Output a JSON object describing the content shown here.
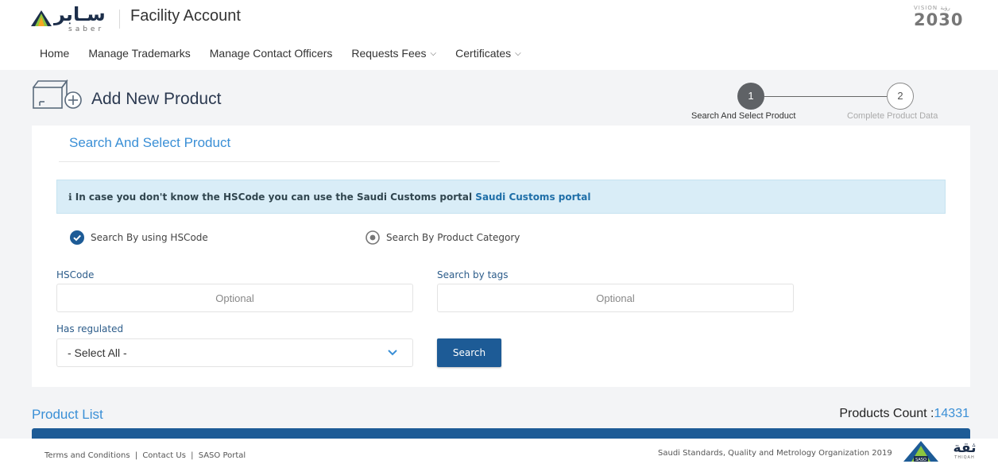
{
  "header": {
    "logo_arabic": "سـابر",
    "logo_latin": "saber",
    "title": "Facility Account",
    "vision_small": "VISION رؤية",
    "vision_year": "2030"
  },
  "nav": {
    "items": [
      {
        "label": "Home"
      },
      {
        "label": "Manage Trademarks"
      },
      {
        "label": "Manage Contact Officers"
      },
      {
        "label": "Requests Fees",
        "dropdown": true
      },
      {
        "label": "Certificates",
        "dropdown": true
      }
    ]
  },
  "page": {
    "title": "Add New Product"
  },
  "stepper": {
    "steps": [
      {
        "number": "1",
        "label": "Search And Select Product",
        "active": true
      },
      {
        "number": "2",
        "label": "Complete Product Data",
        "active": false
      }
    ]
  },
  "search_card": {
    "title": "Search And Select Product",
    "alert_text": "In case you don't know the HSCode you can use the Saudi Customs portal",
    "alert_link": "Saudi Customs portal",
    "radio_hscode": "Search By using HSCode",
    "radio_category": "Search By Product Category",
    "hscode_label": "HSCode",
    "hscode_placeholder": "Optional",
    "tags_label": "Search by tags",
    "tags_placeholder": "Optional",
    "regulated_label": "Has regulated",
    "regulated_value": "- Select All -",
    "search_button": "Search"
  },
  "product_list": {
    "title": "Product List",
    "count_label": "Products Count :",
    "count_value": "14331"
  },
  "footer": {
    "terms": "Terms and Conditions",
    "contact": "Contact Us",
    "portal": "SASO Portal",
    "separator": "|",
    "copyright": "Saudi Standards, Quality and Metrology Organization 2019",
    "saso_badge": "SASO",
    "thiqah_ar": "ثقة",
    "thiqah_en": "THIQAH"
  },
  "colors": {
    "accent_blue": "#3a8fd6",
    "primary_button": "#1d5b96",
    "alert_bg": "#d9edf7",
    "step_active": "#5f6266"
  }
}
